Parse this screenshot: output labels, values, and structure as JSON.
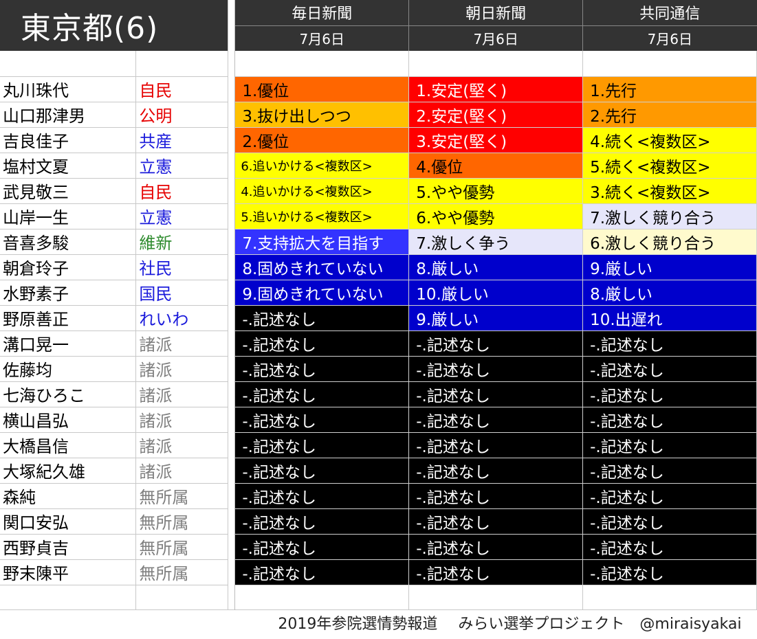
{
  "title": "東京都(6)",
  "papers": [
    {
      "name": "毎日新聞",
      "date": "7月6日"
    },
    {
      "name": "朝日新聞",
      "date": "7月6日"
    },
    {
      "name": "共同通信",
      "date": "7月6日"
    }
  ],
  "candidates": [
    {
      "name": "丸川珠代",
      "party": "自民",
      "party_color": "#e60000",
      "ratings": [
        {
          "text": "1.優位",
          "bg": "#ff6600",
          "fg": "#000000"
        },
        {
          "text": "1.安定(堅く)",
          "bg": "#ff0000",
          "fg": "#ffffff"
        },
        {
          "text": "1.先行",
          "bg": "#ff9900",
          "fg": "#000000"
        }
      ]
    },
    {
      "name": "山口那津男",
      "party": "公明",
      "party_color": "#e60000",
      "ratings": [
        {
          "text": "3.抜け出しつつ",
          "bg": "#ffc000",
          "fg": "#000000"
        },
        {
          "text": "2.安定(堅く)",
          "bg": "#ff0000",
          "fg": "#ffffff"
        },
        {
          "text": "2.先行",
          "bg": "#ff9900",
          "fg": "#000000"
        }
      ]
    },
    {
      "name": "吉良佳子",
      "party": "共産",
      "party_color": "#1a1adb",
      "ratings": [
        {
          "text": "2.優位",
          "bg": "#ff6600",
          "fg": "#000000"
        },
        {
          "text": "3.安定(堅く)",
          "bg": "#ff0000",
          "fg": "#ffffff"
        },
        {
          "text": "4.続く<複数区>",
          "bg": "#ffff00",
          "fg": "#000000"
        }
      ]
    },
    {
      "name": "塩村文夏",
      "party": "立憲",
      "party_color": "#1a1adb",
      "ratings": [
        {
          "text": "6.追いかける<複数区>",
          "bg": "#ffff00",
          "fg": "#000000",
          "small": true
        },
        {
          "text": "4.優位",
          "bg": "#ff6600",
          "fg": "#000000"
        },
        {
          "text": "5.続く<複数区>",
          "bg": "#ffff00",
          "fg": "#000000"
        }
      ]
    },
    {
      "name": "武見敬三",
      "party": "自民",
      "party_color": "#e60000",
      "ratings": [
        {
          "text": "4.追いかける<複数区>",
          "bg": "#ffff00",
          "fg": "#000000",
          "small": true
        },
        {
          "text": "5.やや優勢",
          "bg": "#ffff00",
          "fg": "#000000"
        },
        {
          "text": "3.続く<複数区>",
          "bg": "#ffff00",
          "fg": "#000000"
        }
      ]
    },
    {
      "name": "山岸一生",
      "party": "立憲",
      "party_color": "#1a1adb",
      "ratings": [
        {
          "text": "5.追いかける<複数区>",
          "bg": "#ffff00",
          "fg": "#000000",
          "small": true
        },
        {
          "text": "6.やや優勢",
          "bg": "#ffff00",
          "fg": "#000000"
        },
        {
          "text": "7.激しく競り合う",
          "bg": "#e6e6fa",
          "fg": "#000000"
        }
      ]
    },
    {
      "name": "音喜多駿",
      "party": "維新",
      "party_color": "#2e8b2e",
      "ratings": [
        {
          "text": "7.支持拡大を目指す",
          "bg": "#3333ff",
          "fg": "#ffffff"
        },
        {
          "text": "7.激しく争う",
          "bg": "#e6e6fa",
          "fg": "#000000"
        },
        {
          "text": "6.激しく競り合う",
          "bg": "#fffacd",
          "fg": "#000000"
        }
      ]
    },
    {
      "name": "朝倉玲子",
      "party": "社民",
      "party_color": "#1a1adb",
      "ratings": [
        {
          "text": "8.固めきれていない",
          "bg": "#0000cc",
          "fg": "#ffffff"
        },
        {
          "text": "8.厳しい",
          "bg": "#0000cc",
          "fg": "#ffffff"
        },
        {
          "text": "9.厳しい",
          "bg": "#0000cc",
          "fg": "#ffffff"
        }
      ]
    },
    {
      "name": "水野素子",
      "party": "国民",
      "party_color": "#1a1adb",
      "ratings": [
        {
          "text": "9.固めきれていない",
          "bg": "#0000cc",
          "fg": "#ffffff"
        },
        {
          "text": "10.厳しい",
          "bg": "#0000cc",
          "fg": "#ffffff"
        },
        {
          "text": "8.厳しい",
          "bg": "#0000cc",
          "fg": "#ffffff"
        }
      ]
    },
    {
      "name": "野原善正",
      "party": "れいわ",
      "party_color": "#1a1adb",
      "ratings": [
        {
          "text": "-.記述なし",
          "bg": "#000000",
          "fg": "#ffffff"
        },
        {
          "text": "9.厳しい",
          "bg": "#0000cc",
          "fg": "#ffffff"
        },
        {
          "text": "10.出遅れ",
          "bg": "#0000cc",
          "fg": "#ffffff"
        }
      ]
    },
    {
      "name": "溝口晃一",
      "party": "諸派",
      "party_color": "#808080",
      "ratings": [
        {
          "text": "-.記述なし",
          "bg": "#000000",
          "fg": "#ffffff"
        },
        {
          "text": "-.記述なし",
          "bg": "#000000",
          "fg": "#ffffff"
        },
        {
          "text": "-.記述なし",
          "bg": "#000000",
          "fg": "#ffffff"
        }
      ]
    },
    {
      "name": "佐藤均",
      "party": "諸派",
      "party_color": "#808080",
      "ratings": [
        {
          "text": "-.記述なし",
          "bg": "#000000",
          "fg": "#ffffff"
        },
        {
          "text": "-.記述なし",
          "bg": "#000000",
          "fg": "#ffffff"
        },
        {
          "text": "-.記述なし",
          "bg": "#000000",
          "fg": "#ffffff"
        }
      ]
    },
    {
      "name": "七海ひろこ",
      "party": "諸派",
      "party_color": "#808080",
      "ratings": [
        {
          "text": "-.記述なし",
          "bg": "#000000",
          "fg": "#ffffff"
        },
        {
          "text": "-.記述なし",
          "bg": "#000000",
          "fg": "#ffffff"
        },
        {
          "text": "-.記述なし",
          "bg": "#000000",
          "fg": "#ffffff"
        }
      ]
    },
    {
      "name": "横山昌弘",
      "party": "諸派",
      "party_color": "#808080",
      "ratings": [
        {
          "text": "-.記述なし",
          "bg": "#000000",
          "fg": "#ffffff"
        },
        {
          "text": "-.記述なし",
          "bg": "#000000",
          "fg": "#ffffff"
        },
        {
          "text": "-.記述なし",
          "bg": "#000000",
          "fg": "#ffffff"
        }
      ]
    },
    {
      "name": "大橋昌信",
      "party": "諸派",
      "party_color": "#808080",
      "ratings": [
        {
          "text": "-.記述なし",
          "bg": "#000000",
          "fg": "#ffffff"
        },
        {
          "text": "-.記述なし",
          "bg": "#000000",
          "fg": "#ffffff"
        },
        {
          "text": "-.記述なし",
          "bg": "#000000",
          "fg": "#ffffff"
        }
      ]
    },
    {
      "name": "大塚紀久雄",
      "party": "諸派",
      "party_color": "#808080",
      "ratings": [
        {
          "text": "-.記述なし",
          "bg": "#000000",
          "fg": "#ffffff"
        },
        {
          "text": "-.記述なし",
          "bg": "#000000",
          "fg": "#ffffff"
        },
        {
          "text": "-.記述なし",
          "bg": "#000000",
          "fg": "#ffffff"
        }
      ]
    },
    {
      "name": "森純",
      "party": "無所属",
      "party_color": "#808080",
      "ratings": [
        {
          "text": "-.記述なし",
          "bg": "#000000",
          "fg": "#ffffff"
        },
        {
          "text": "-.記述なし",
          "bg": "#000000",
          "fg": "#ffffff"
        },
        {
          "text": "-.記述なし",
          "bg": "#000000",
          "fg": "#ffffff"
        }
      ]
    },
    {
      "name": "関口安弘",
      "party": "無所属",
      "party_color": "#808080",
      "ratings": [
        {
          "text": "-.記述なし",
          "bg": "#000000",
          "fg": "#ffffff"
        },
        {
          "text": "-.記述なし",
          "bg": "#000000",
          "fg": "#ffffff"
        },
        {
          "text": "-.記述なし",
          "bg": "#000000",
          "fg": "#ffffff"
        }
      ]
    },
    {
      "name": "西野貞吉",
      "party": "無所属",
      "party_color": "#808080",
      "ratings": [
        {
          "text": "-.記述なし",
          "bg": "#000000",
          "fg": "#ffffff"
        },
        {
          "text": "-.記述なし",
          "bg": "#000000",
          "fg": "#ffffff"
        },
        {
          "text": "-.記述なし",
          "bg": "#000000",
          "fg": "#ffffff"
        }
      ]
    },
    {
      "name": "野末陳平",
      "party": "無所属",
      "party_color": "#808080",
      "ratings": [
        {
          "text": "-.記述なし",
          "bg": "#000000",
          "fg": "#ffffff"
        },
        {
          "text": "-.記述なし",
          "bg": "#000000",
          "fg": "#ffffff"
        },
        {
          "text": "-.記述なし",
          "bg": "#000000",
          "fg": "#ffffff"
        }
      ]
    }
  ],
  "footer": {
    "report": "2019年参院選情勢報道",
    "project": "みらい選挙プロジェクト",
    "handle": "@miraisyakai"
  }
}
